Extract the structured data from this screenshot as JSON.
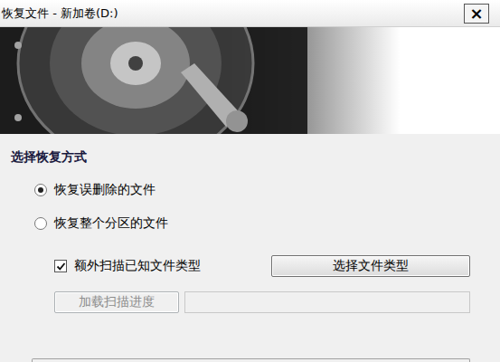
{
  "window": {
    "title": "恢复文件 - 新加卷(D:)",
    "close": "×"
  },
  "section": {
    "title": "选择恢复方式"
  },
  "modes": [
    {
      "label": "恢复误删除的文件",
      "selected": true
    },
    {
      "label": "恢复整个分区的文件",
      "selected": false
    }
  ],
  "options": [
    {
      "label": "额外扫描已知文件类型",
      "checked": true
    }
  ],
  "buttons": [
    {
      "label": "选择文件类型",
      "disabled": false
    }
  ],
  "progress": {
    "button": "加载扫描进度",
    "value": "",
    "disabled": true
  }
}
